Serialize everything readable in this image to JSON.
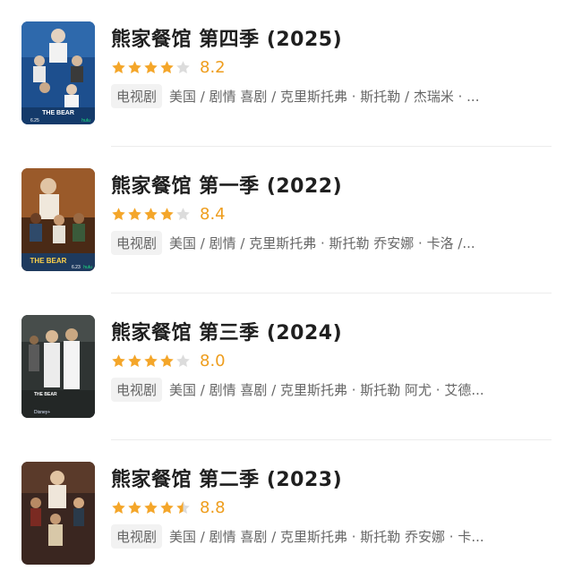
{
  "colors": {
    "star_filled": "#f4a62a",
    "star_empty": "#dcdcdc",
    "score": "#ee9d1d"
  },
  "items": [
    {
      "title": "熊家餐馆 第四季 (2025)",
      "stars": 4,
      "score": "8.2",
      "tag": "电视剧",
      "info": "美国 / 剧情 喜剧 / 克里斯托弗 · 斯托勒 / 杰瑞米 · ...",
      "poster": {
        "caption": "THE BEAR",
        "date": "6.25",
        "network": "hulu",
        "icon": "poster-image-blue"
      }
    },
    {
      "title": "熊家餐馆 第一季 (2022)",
      "stars": 4,
      "score": "8.4",
      "tag": "电视剧",
      "info": "美国 / 剧情 / 克里斯托弗 · 斯托勒 乔安娜 · 卡洛 /...",
      "poster": {
        "caption": "THE BEAR",
        "date": "6.23",
        "network": "hulu",
        "icon": "poster-image-kitchen"
      }
    },
    {
      "title": "熊家餐馆 第三季 (2024)",
      "stars": 4,
      "score": "8.0",
      "tag": "电视剧",
      "info": "美国 / 剧情 喜剧 / 克里斯托弗 · 斯托勒 阿尤 · 艾德...",
      "poster": {
        "caption": "THE BEAR",
        "date": "",
        "network": "Disney+",
        "icon": "poster-image-chefs"
      }
    },
    {
      "title": "熊家餐馆 第二季 (2023)",
      "stars": 4.5,
      "score": "8.8",
      "tag": "电视剧",
      "info": "美国 / 剧情 喜剧 / 克里斯托弗 · 斯托勒 乔安娜 · 卡...",
      "poster": {
        "caption": "",
        "date": "",
        "network": "",
        "icon": "poster-image-ensemble"
      }
    }
  ]
}
